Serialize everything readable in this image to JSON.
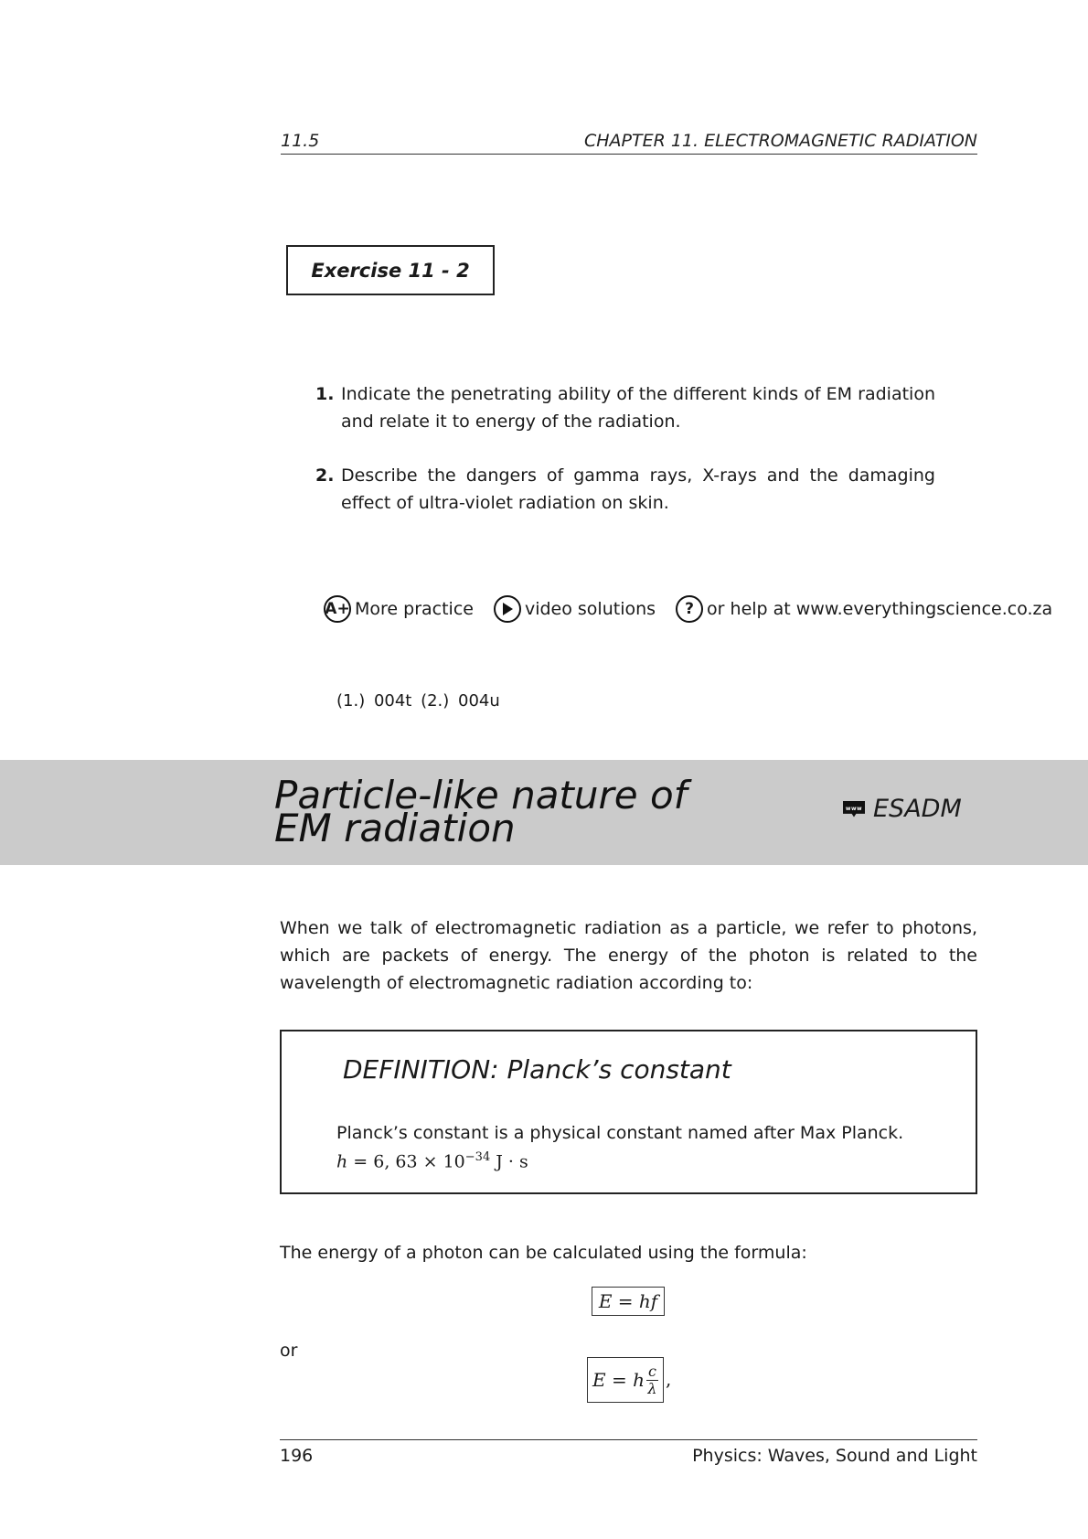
{
  "header": {
    "section": "11.5",
    "chapter": "CHAPTER 11.  ELECTROMAGNETIC RADIATION"
  },
  "exercise": {
    "title": "Exercise 11  - 2",
    "questions": [
      {
        "num": "1.",
        "text": "Indicate the penetrating ability of the different kinds of EM radiation and relate it to energy of the radiation."
      },
      {
        "num": "2.",
        "text": "Describe the dangers of gamma rays, X-rays and the damaging effect of ultra-violet radiation on skin."
      }
    ]
  },
  "help": {
    "more_practice": "More practice",
    "video_solutions": "video solutions",
    "help_text": "or help at www.everythingscience.co.za",
    "icon_a_plus": "A+",
    "icon_question": "?"
  },
  "codes": "(1.) 004t   (2.) 004u",
  "section_banner": {
    "title_line1": "Particle-like nature of",
    "title_line2": "EM radiation",
    "icon_text": "www",
    "code": "ESADM",
    "background": "#cbcbcb"
  },
  "body": {
    "intro": "When we talk of electromagnetic radiation as a particle, we refer to photons, which are packets of energy. The energy of the photon is related to the wavelength of electromagnetic radiation according to:",
    "formula_intro": "The energy of a photon can be calculated using the formula:",
    "or": "or"
  },
  "definition": {
    "title": "DEFINITION:  Planck’s constant",
    "text": "Planck’s constant is a physical constant named after Max Planck.",
    "formula_lhs": "h",
    "formula_rhs": " = 6, 63 × 10",
    "formula_exp": "−34",
    "formula_unit": " J · s"
  },
  "formulas": {
    "f1": "E = hf",
    "f2_prefix": "E = h",
    "f2_num": "c",
    "f2_den": "λ",
    "f2_suffix": ","
  },
  "footer": {
    "page": "196",
    "book": "Physics: Waves, Sound and Light"
  }
}
